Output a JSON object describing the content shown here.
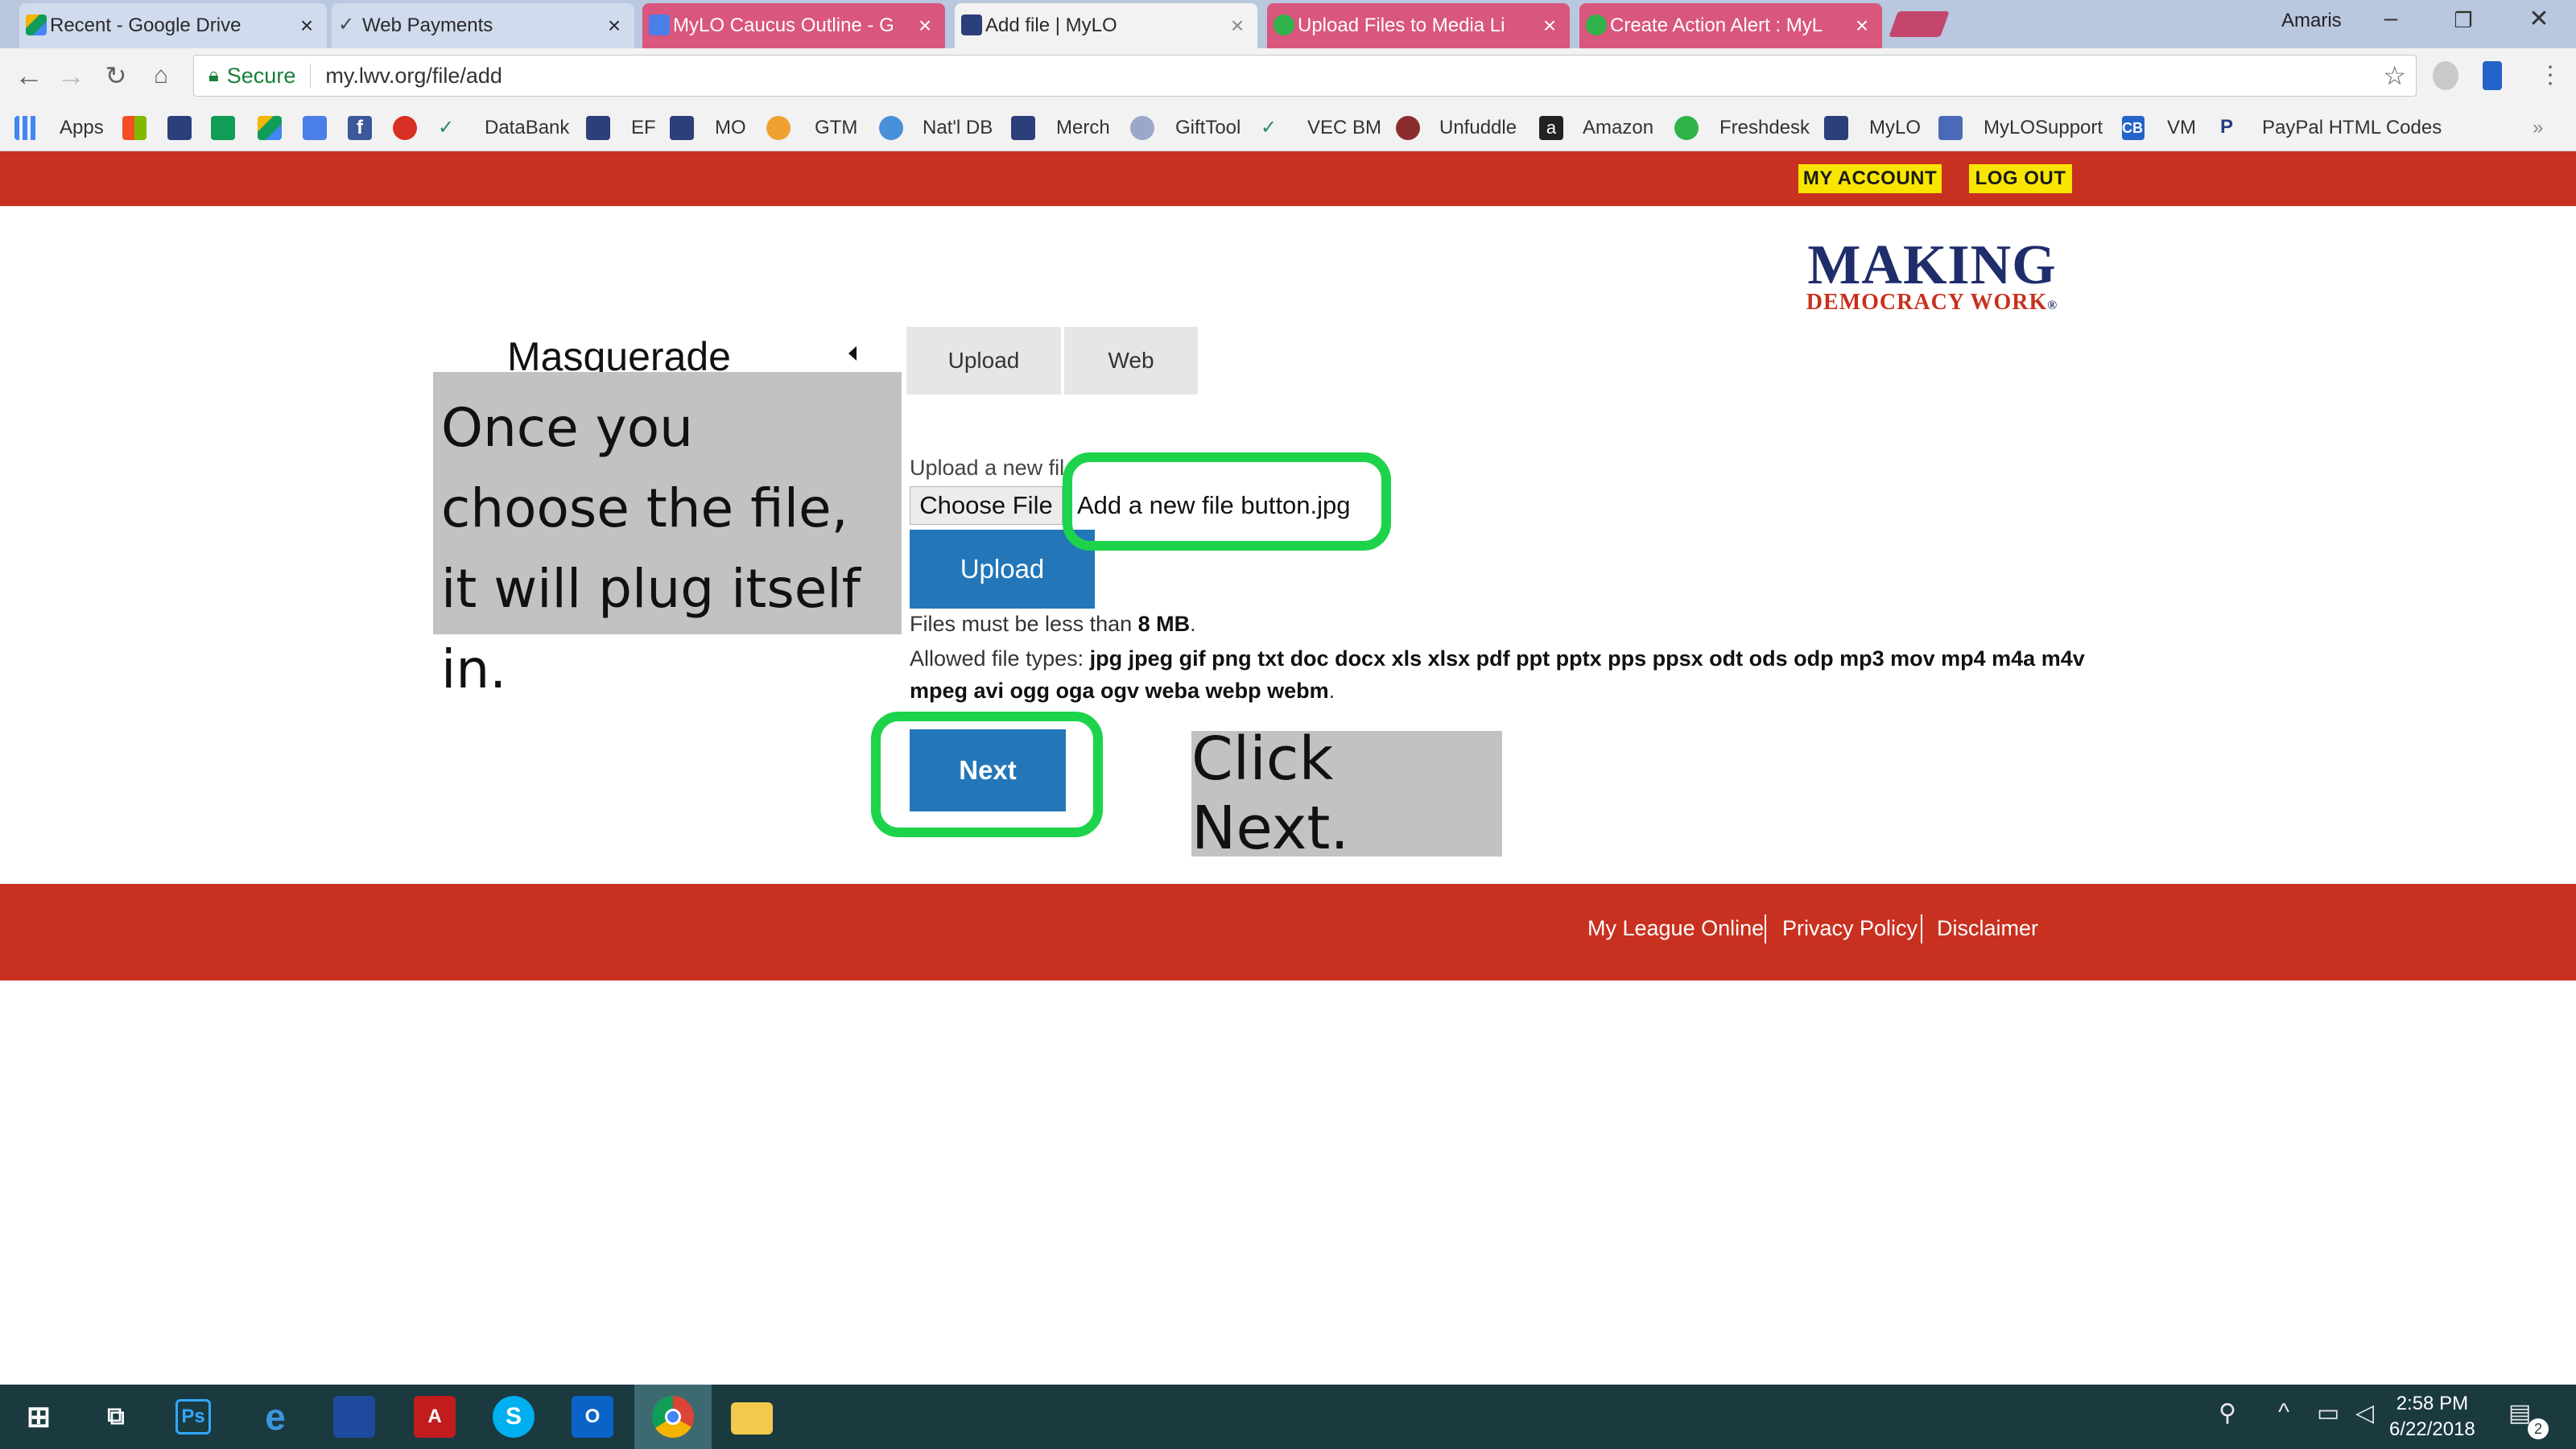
{
  "browser": {
    "tabs": [
      {
        "title": "Recent - Google Drive",
        "icon": "google-drive-icon"
      },
      {
        "title": "Web Payments",
        "icon": "check-wave-icon"
      },
      {
        "title": "MyLO Caucus Outline - G",
        "icon": "google-docs-icon"
      },
      {
        "title": "Add file | MyLO",
        "icon": "mylo-icon"
      },
      {
        "title": "Upload Files to Media Li",
        "icon": "freshdesk-icon"
      },
      {
        "title": "Create Action Alert : MyL",
        "icon": "freshdesk-icon"
      }
    ],
    "user": "Amaris",
    "secure_label": "Secure",
    "url": "my.lwv.org/file/add",
    "bookmarks": [
      "Apps",
      "DataBank",
      "EF",
      "MO",
      "GTM",
      "Nat'l DB",
      "Merch",
      "GiftTool",
      "VEC BM",
      "Unfuddle",
      "Amazon",
      "Freshdesk",
      "MyLO",
      "MyLOSupport",
      "CB",
      "VM",
      "PayPal HTML Codes"
    ]
  },
  "header": {
    "my_account": "MY ACCOUNT",
    "log_out": "LOG OUT",
    "logo_line1": "MAKING",
    "logo_line2": "DEMOCRACY WORK",
    "logo_reg": "®"
  },
  "sidebar": {
    "masquerade": "Masquerade"
  },
  "tabs": {
    "upload": "Upload",
    "web": "Web"
  },
  "form": {
    "upload_label": "Upload a new fil",
    "choose_file": "Choose File",
    "file_name": "Add a new file button.jpg",
    "upload_button": "Upload",
    "size_prefix": "Files must be less than ",
    "size_value": "8 MB",
    "size_suffix": ".",
    "types_prefix": "Allowed file types: ",
    "types_value": "jpg jpeg gif png txt doc docx xls xlsx pdf ppt pptx pps ppsx odt ods odp mp3 mov mp4 m4a m4v mpeg avi ogg oga ogv weba webp webm",
    "types_suffix": ".",
    "next_button": "Next"
  },
  "annotations": {
    "note1": "Once you choose the file, it will plug itself in.",
    "note2": "Click Next."
  },
  "footer": {
    "links": [
      "My League Online",
      "Privacy Policy",
      "Disclaimer"
    ]
  },
  "taskbar": {
    "time": "2:58 PM",
    "date": "6/22/2018",
    "notification_count": "2"
  },
  "colors": {
    "brand_red": "#c8311f",
    "button_blue": "#2377b9",
    "highlight_green": "#1dd34b",
    "account_yellow": "#f9e600"
  }
}
